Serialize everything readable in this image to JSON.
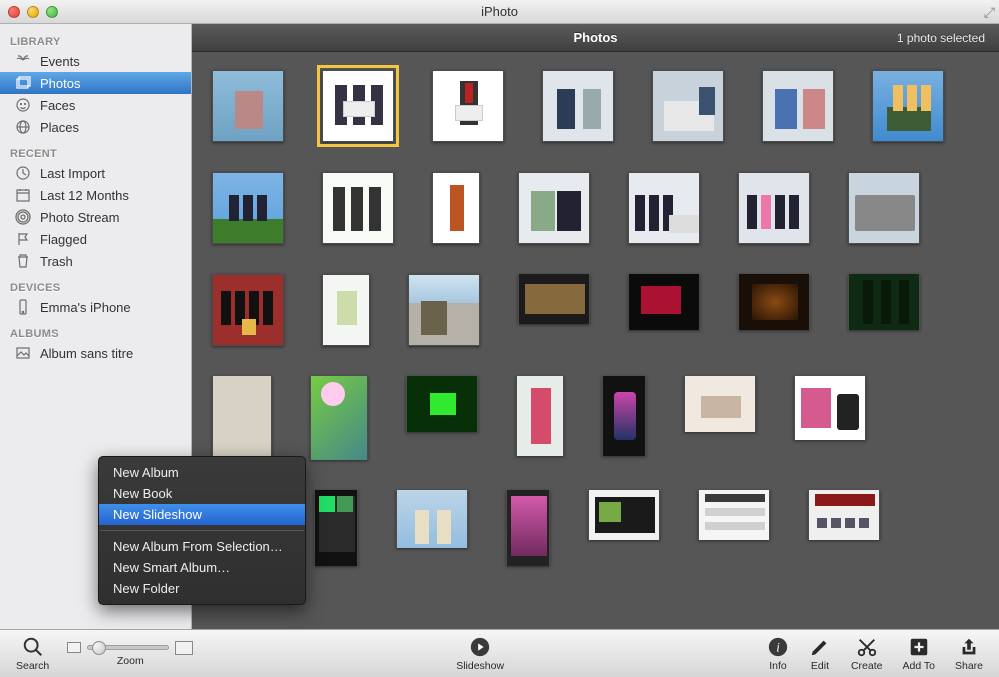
{
  "window": {
    "title": "iPhoto"
  },
  "header": {
    "title": "Photos",
    "status": "1 photo selected"
  },
  "sidebar": {
    "sections": [
      {
        "heading": "LIBRARY",
        "items": [
          {
            "icon": "palm-tree-icon",
            "label": "Events"
          },
          {
            "icon": "photo-stack-icon",
            "label": "Photos",
            "selected": true
          },
          {
            "icon": "face-icon",
            "label": "Faces"
          },
          {
            "icon": "globe-icon",
            "label": "Places"
          }
        ]
      },
      {
        "heading": "RECENT",
        "items": [
          {
            "icon": "clock-icon",
            "label": "Last Import"
          },
          {
            "icon": "calendar-icon",
            "label": "Last 12 Months"
          },
          {
            "icon": "stream-icon",
            "label": "Photo Stream"
          },
          {
            "icon": "flag-icon",
            "label": "Flagged"
          },
          {
            "icon": "trash-icon",
            "label": "Trash"
          }
        ]
      },
      {
        "heading": "DEVICES",
        "items": [
          {
            "icon": "phone-icon",
            "label": "Emma's iPhone"
          }
        ]
      },
      {
        "heading": "ALBUMS",
        "items": [
          {
            "icon": "album-icon",
            "label": "Album sans titre"
          }
        ]
      }
    ]
  },
  "context_menu": {
    "items_a": [
      "New Album",
      "New Book",
      "New Slideshow"
    ],
    "highlighted_index": 2,
    "items_b": [
      "New Album From Selection…",
      "New Smart Album…",
      "New Folder"
    ]
  },
  "toolbar": {
    "search": "Search",
    "zoom": "Zoom",
    "slideshow": "Slideshow",
    "info": "Info",
    "edit": "Edit",
    "create": "Create",
    "add_to": "Add To",
    "share": "Share"
  }
}
